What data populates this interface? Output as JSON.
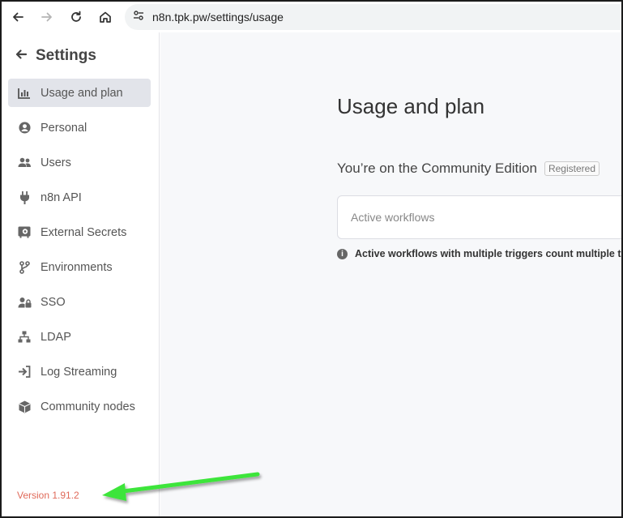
{
  "browser": {
    "url_host": "n8n.tpk.pw",
    "url_path": "/settings/usage",
    "icons": [
      "back-arrow-icon",
      "forward-arrow-icon",
      "reload-icon",
      "home-icon",
      "site-settings-icon"
    ]
  },
  "sidebar": {
    "title": "Settings",
    "items": [
      {
        "label": "Usage and plan",
        "icon": "bar-chart-icon",
        "active": true
      },
      {
        "label": "Personal",
        "icon": "user-circle-icon",
        "active": false
      },
      {
        "label": "Users",
        "icon": "users-icon",
        "active": false
      },
      {
        "label": "n8n API",
        "icon": "plug-icon",
        "active": false
      },
      {
        "label": "External Secrets",
        "icon": "vault-icon",
        "active": false
      },
      {
        "label": "Environments",
        "icon": "git-branch-icon",
        "active": false
      },
      {
        "label": "SSO",
        "icon": "user-lock-icon",
        "active": false
      },
      {
        "label": "LDAP",
        "icon": "network-icon",
        "active": false
      },
      {
        "label": "Log Streaming",
        "icon": "sign-in-icon",
        "active": false
      },
      {
        "label": "Community nodes",
        "icon": "cube-icon",
        "active": false
      }
    ],
    "version": "Version 1.91.2"
  },
  "main": {
    "title": "Usage and plan",
    "edition_text": "You’re on the Community Edition",
    "edition_badge": "Registered",
    "card_label": "Active workflows",
    "info_text": "Active workflows with multiple triggers count multiple times"
  },
  "colors": {
    "version_text": "#e06a5a",
    "annotation_arrow": "#3ee53a",
    "active_item_bg": "#e2e4ea"
  }
}
